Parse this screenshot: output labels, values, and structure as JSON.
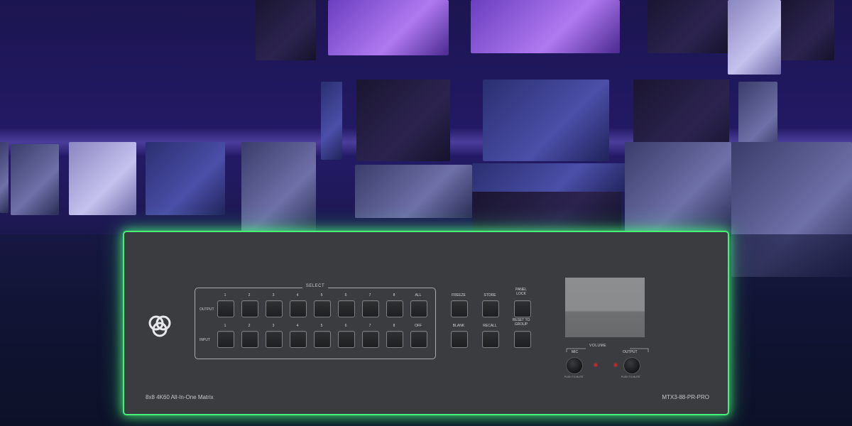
{
  "device": {
    "product_name": "8x8 4K60 All-In-One Matrix",
    "model": "MTX3-88-PR-PRO",
    "logo_icon": "triple-ring-logo-icon",
    "accent_glow_color": "#46f07a",
    "select_title": "SELECT",
    "output_row_label": "OUTPUT",
    "input_row_label": "INPUT",
    "output_buttons": [
      "1",
      "2",
      "3",
      "4",
      "5",
      "6",
      "7",
      "8",
      "ALL"
    ],
    "input_buttons": [
      "1",
      "2",
      "3",
      "4",
      "5",
      "6",
      "7",
      "8",
      "OFF"
    ],
    "control_buttons_top": [
      "FREEZE",
      "STORE",
      "PANEL LOCK"
    ],
    "control_buttons_bottom": [
      "BLANK",
      "RECALL",
      "RESET TO GROUP"
    ],
    "volume_title": "VOLUME",
    "mic_label": "MIC",
    "mic_sub": "PUSH TO MUTE",
    "output_label": "OUTPUT",
    "output_sub": "PUSH TO MUTE"
  }
}
